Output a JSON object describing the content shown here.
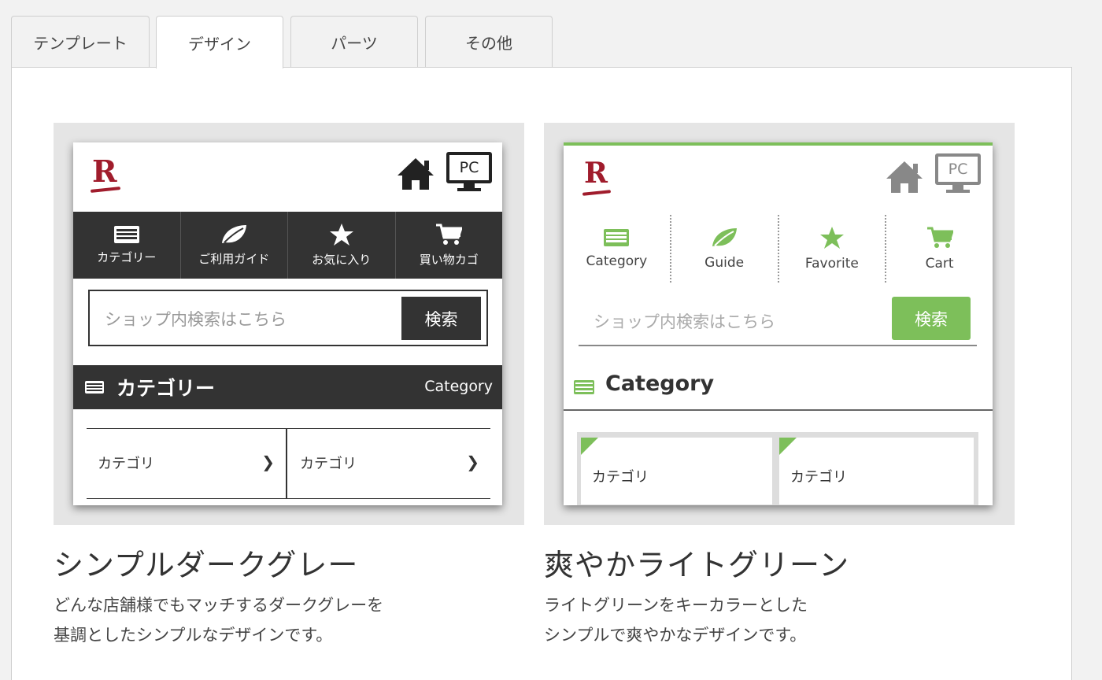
{
  "tabs": [
    {
      "label": "テンプレート",
      "active": false
    },
    {
      "label": "デザイン",
      "active": true
    },
    {
      "label": "パーツ",
      "active": false
    },
    {
      "label": "その他",
      "active": false
    }
  ],
  "designs": [
    {
      "name": "シンプルダークグレー",
      "description_lines": [
        "どんな店舗様でもマッチするダークグレーを",
        "基調としたシンプルなデザインです。"
      ],
      "preview": {
        "logo": "R",
        "pc_label": "PC",
        "nav": [
          "カテゴリー",
          "ご利用ガイド",
          "お気に入り",
          "買い物カゴ"
        ],
        "search_placeholder": "ショップ内検索はこちら",
        "search_button": "検索",
        "category_title": "カテゴリー",
        "category_sub": "Category",
        "items": [
          "カテゴリ",
          "カテゴリ"
        ],
        "accent": "#333333"
      }
    },
    {
      "name": "爽やかライトグリーン",
      "description_lines": [
        "ライトグリーンをキーカラーとした",
        "シンプルで爽やかなデザインです。"
      ],
      "preview": {
        "logo": "R",
        "pc_label": "PC",
        "nav": [
          "Category",
          "Guide",
          "Favorite",
          "Cart"
        ],
        "search_placeholder": "ショップ内検索はこちら",
        "search_button": "検索",
        "category_title": "Category",
        "items": [
          "カテゴリ",
          "カテゴリ"
        ],
        "accent": "#7dbf5a"
      }
    }
  ]
}
